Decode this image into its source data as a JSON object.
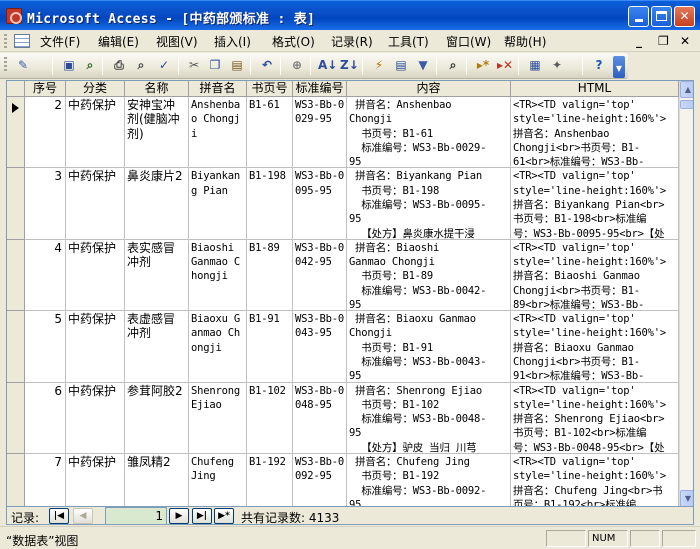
{
  "window": {
    "title": "Microsoft Access - [中药部颁标准 : 表]"
  },
  "menu": {
    "items": [
      "文件(F)",
      "编辑(E)",
      "视图(V)",
      "插入(I)",
      "格式(O)",
      "记录(R)",
      "工具(T)",
      "窗口(W)",
      "帮助(H)"
    ]
  },
  "toolbar": {
    "icons": [
      "design-view-icon",
      "save-icon",
      "file-search-icon",
      "print-icon",
      "print-preview-icon",
      "spelling-icon",
      "cut-icon",
      "copy-icon",
      "paste-icon",
      "undo-icon",
      "hyperlink-icon",
      "sort-ascending-icon",
      "sort-descending-icon",
      "filter-by-selection-icon",
      "filter-by-form-icon",
      "apply-filter-icon",
      "find-icon",
      "new-record-icon",
      "delete-record-icon",
      "database-window-icon",
      "new-object-icon",
      "help-icon"
    ]
  },
  "table": {
    "columns": [
      "序号",
      "分类",
      "名称",
      "拼音名",
      "书页号",
      "标准编号",
      "内容",
      "HTML"
    ],
    "rows": [
      {
        "seq": "2",
        "category": "中药保护",
        "name": "安神宝冲剂(健脑冲剂)",
        "pinyin": "Anshenbao Chongji",
        "page": "B1-61",
        "std": "WS3-Bb-0029-95",
        "content": [
          " 拼音名：Anshenbao",
          "Chongji",
          "  书页号：B1-61",
          "  标准编号：WS3-Bb-0029-",
          "95"
        ],
        "html": [
          "<TR><TD valign='top'",
          "style='line-height:160%'>",
          "拼音名：Anshenbao",
          "Chongji<br>书页号：B1-",
          "61<br>标准编号：WS3-Bb-"
        ]
      },
      {
        "seq": "3",
        "category": "中药保护",
        "name": "鼻炎康片2",
        "pinyin": "Biyankang Pian",
        "page": "B1-198",
        "std": "WS3-Bb-0095-95",
        "content": [
          " 拼音名：Biyankang Pian",
          "  书页号：B1-198",
          "  标准编号：WS3-Bb-0095-",
          "95",
          "  【处方】鼻炎康水提干浸"
        ],
        "html": [
          "<TR><TD valign='top'",
          "style='line-height:160%'>",
          "拼音名：Biyankang Pian<br>",
          "书页号：B1-198<br>标准编",
          "号：WS3-Bb-0095-95<br>【处"
        ]
      },
      {
        "seq": "4",
        "category": "中药保护",
        "name": "表实感冒冲剂",
        "pinyin": "Biaoshi Ganmao Chongji",
        "page": "B1-89",
        "std": "WS3-Bb-0042-95",
        "content": [
          " 拼音名：Biaoshi",
          "Ganmao Chongji",
          "  书页号：B1-89",
          "  标准编号：WS3-Bb-0042-",
          "95"
        ],
        "html": [
          "<TR><TD valign='top'",
          "style='line-height:160%'>",
          "拼音名：Biaoshi Ganmao",
          "Chongji<br>书页号：B1-",
          "89<br>标准编号：WS3-Bb-"
        ]
      },
      {
        "seq": "5",
        "category": "中药保护",
        "name": "表虚感冒冲剂",
        "pinyin": "Biaoxu Ganmao Chongji",
        "page": "B1-91",
        "std": "WS3-Bb-0043-95",
        "content": [
          " 拼音名：Biaoxu Ganmao",
          "Chongji",
          "  书页号：B1-91",
          "  标准编号：WS3-Bb-0043-",
          "95"
        ],
        "html": [
          "<TR><TD valign='top'",
          "style='line-height:160%'>",
          "拼音名：Biaoxu Ganmao",
          "Chongji<br>书页号：B1-",
          "91<br>标准编号：WS3-Bb-"
        ]
      },
      {
        "seq": "6",
        "category": "中药保护",
        "name": "参茸阿胶2",
        "pinyin": "Shenrong Ejiao",
        "page": "B1-102",
        "std": "WS3-Bb-0048-95",
        "content": [
          " 拼音名：Shenrong Ejiao",
          "  书页号：B1-102",
          "  标准编号：WS3-Bb-0048-",
          "95",
          "  【处方】驴皮 当归 川芎"
        ],
        "html": [
          "<TR><TD valign='top'",
          "style='line-height:160%'>",
          "拼音名：Shenrong Ejiao<br>",
          "书页号：B1-102<br>标准编",
          "号：WS3-Bb-0048-95<br>【处"
        ]
      },
      {
        "seq": "7",
        "category": "中药保护",
        "name": "雏凤精2",
        "pinyin": "Chufeng Jing",
        "page": "B1-192",
        "std": "WS3-Bb-0092-95",
        "content": [
          " 拼音名：Chufeng Jing",
          "  书页号：B1-192",
          "  标准编号：WS3-Bb-0092-",
          "95"
        ],
        "html": [
          "<TR><TD valign='top'",
          "style='line-height:160%'>",
          "拼音名：Chufeng Jing<br>书",
          "页号：B1-192<br>标准编"
        ]
      }
    ]
  },
  "navigation": {
    "label": "记录:",
    "current": "1",
    "total_text": "共有记录数: 4133"
  },
  "status": {
    "text": "“数据表”视图",
    "indicator": "NUM"
  }
}
